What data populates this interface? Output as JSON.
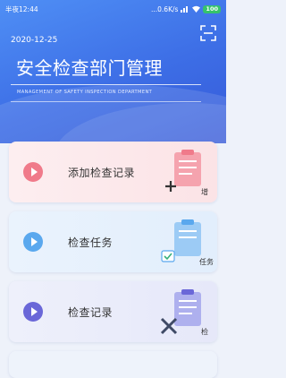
{
  "status": {
    "time": "半夜12:44",
    "speed": "...0.6K/s",
    "battery": "100"
  },
  "header": {
    "date": "2020-12-25",
    "title": "安全检查部门管理",
    "subtitle": "MANAGEMENT OF SAFETY INSPECTION DEPARTMENT"
  },
  "menu": [
    {
      "label": "添加检查记录",
      "badge": "增",
      "icon": "plus-clipboard-icon",
      "color": "#f07a8a"
    },
    {
      "label": "检查任务",
      "badge": "任务",
      "icon": "check-clipboard-icon",
      "color": "#5aa8ee"
    },
    {
      "label": "检查记录",
      "badge": "检",
      "icon": "tools-clipboard-icon",
      "color": "#6a67d8"
    }
  ]
}
